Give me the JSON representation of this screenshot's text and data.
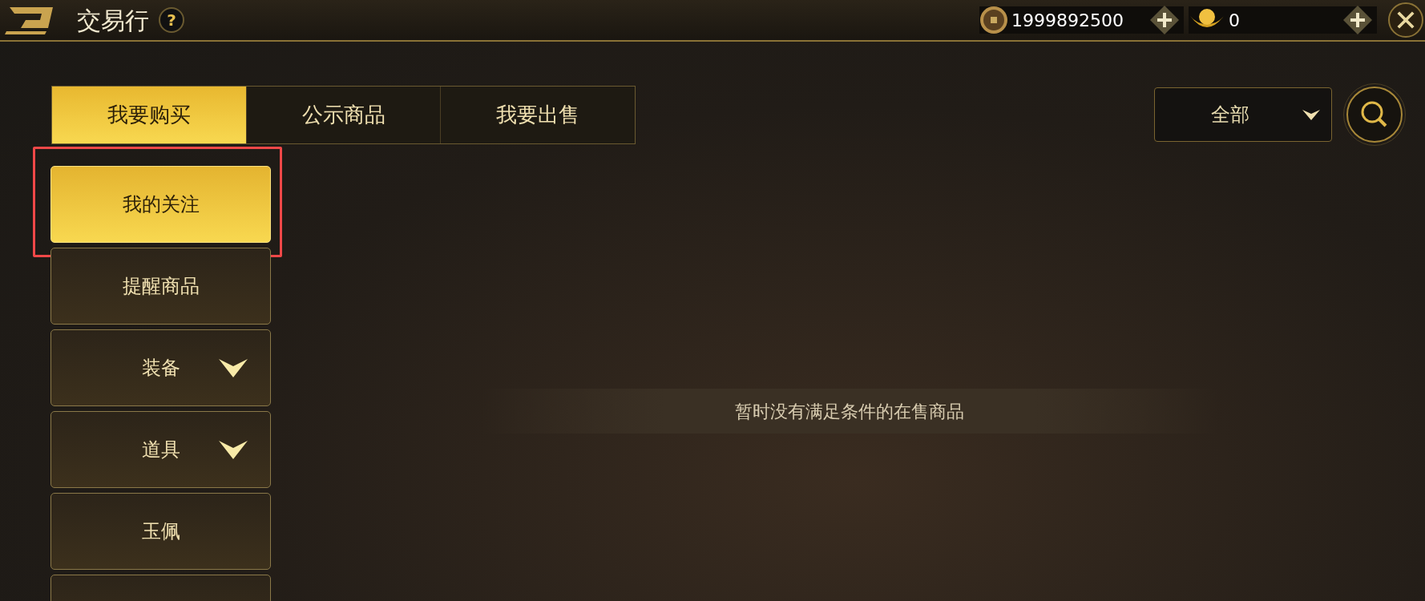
{
  "header": {
    "title": "交易行",
    "help": "?"
  },
  "currencies": [
    {
      "kind": "coin",
      "amount": "1999892500"
    },
    {
      "kind": "ingot",
      "amount": "0"
    }
  ],
  "tabs": [
    {
      "label": "我要购买",
      "selected": true
    },
    {
      "label": "公示商品",
      "selected": false
    },
    {
      "label": "我要出售",
      "selected": false
    }
  ],
  "filter": {
    "value": "全部"
  },
  "sidebar": {
    "items": [
      {
        "label": "我的关注",
        "selected": true,
        "highlighted": true,
        "expandable": false
      },
      {
        "label": "提醒商品",
        "selected": false,
        "highlighted": false,
        "expandable": false
      },
      {
        "label": "装备",
        "selected": false,
        "highlighted": false,
        "expandable": true
      },
      {
        "label": "道具",
        "selected": false,
        "highlighted": false,
        "expandable": true
      },
      {
        "label": "玉佩",
        "selected": false,
        "highlighted": false,
        "expandable": false
      },
      {
        "selected": false,
        "highlighted": false,
        "expandable": false
      }
    ]
  },
  "empty_message": "暂时没有满足条件的在售商品"
}
